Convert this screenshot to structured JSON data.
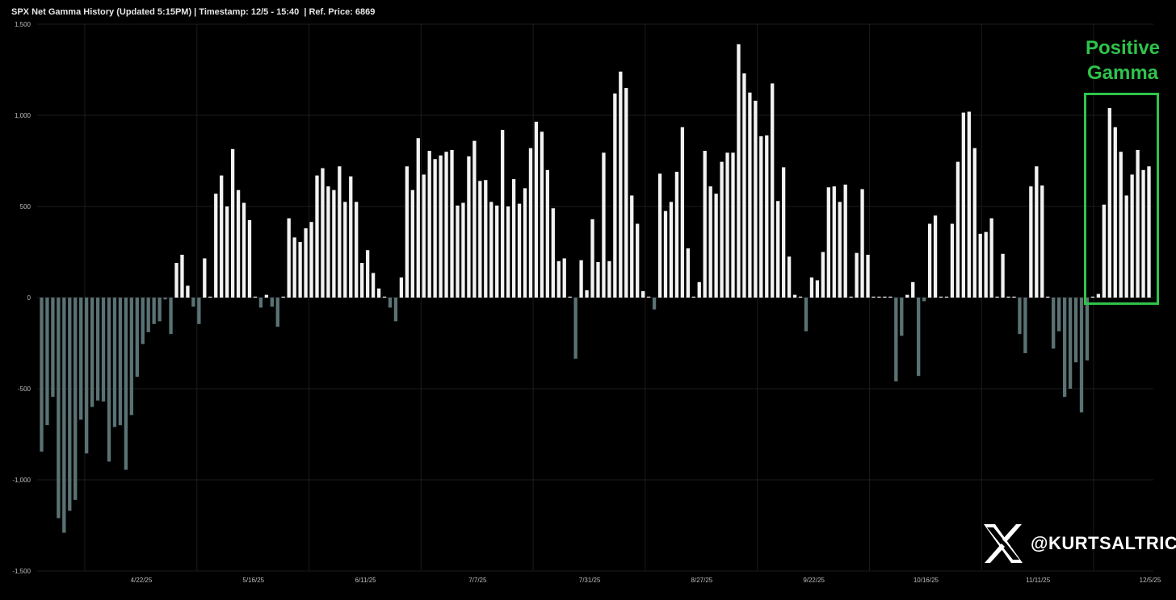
{
  "chart_data": {
    "type": "bar",
    "title": "SPX Net Gamma History (Updated 5:15PM) | Timestamp: 12/5 - 15:40  | Ref. Price: 6869",
    "xlabel": "",
    "ylabel": "",
    "ylim": [
      -1500,
      1500
    ],
    "yticks": [
      1500,
      1000,
      500,
      0,
      -500,
      -1000,
      -1500
    ],
    "ytick_labels": [
      "1,500",
      "1,000",
      "500",
      "0",
      "-500",
      "-1,000",
      "-1,500"
    ],
    "xtick_labels": [
      "4/22/25",
      "5/16/25",
      "6/11/25",
      "7/7/25",
      "7/31/25",
      "8/27/25",
      "9/22/25",
      "10/16/25",
      "11/11/25",
      "12/5/25"
    ],
    "grid": true,
    "colors": {
      "positive": "#f2f2f2",
      "negative": "#5a7274",
      "grid": "#1c1c1c",
      "background": "#000000"
    },
    "values": [
      -845,
      -700,
      -545,
      -1210,
      -1290,
      -1170,
      -1110,
      -670,
      -855,
      -600,
      -565,
      -570,
      -900,
      -710,
      -700,
      -945,
      -645,
      -435,
      -255,
      -190,
      -145,
      -130,
      -10,
      -200,
      190,
      235,
      65,
      -50,
      -145,
      215,
      0,
      570,
      670,
      500,
      815,
      590,
      520,
      425,
      0,
      -55,
      15,
      -50,
      -160,
      0,
      435,
      330,
      305,
      380,
      415,
      670,
      710,
      610,
      590,
      720,
      525,
      665,
      525,
      190,
      260,
      135,
      50,
      0,
      -55,
      -130,
      110,
      720,
      590,
      875,
      675,
      805,
      760,
      780,
      800,
      810,
      505,
      520,
      775,
      860,
      640,
      645,
      525,
      505,
      920,
      500,
      650,
      515,
      600,
      820,
      965,
      910,
      700,
      490,
      200,
      215,
      0,
      -335,
      205,
      40,
      430,
      195,
      795,
      200,
      1120,
      1240,
      1150,
      560,
      405,
      35,
      0,
      -65,
      680,
      475,
      525,
      690,
      935,
      270,
      0,
      85,
      805,
      610,
      570,
      745,
      795,
      795,
      1390,
      1230,
      1125,
      1080,
      885,
      890,
      1175,
      530,
      715,
      225,
      15,
      0,
      -185,
      110,
      95,
      250,
      605,
      610,
      525,
      620,
      0,
      245,
      595,
      235,
      0,
      0,
      0,
      0,
      -460,
      -210,
      15,
      85,
      -430,
      -20,
      405,
      450,
      0,
      0,
      405,
      745,
      1015,
      1020,
      820,
      350,
      360,
      435,
      0,
      240,
      0,
      0,
      -200,
      -305,
      610,
      720,
      615,
      0,
      -280,
      -185,
      -545,
      -500,
      -355,
      -630,
      -345,
      0,
      20,
      510,
      1040,
      935,
      800,
      560,
      675,
      810,
      700,
      720
    ]
  },
  "callout": {
    "line1": "Positive",
    "line2": "Gamma"
  },
  "watermark": {
    "icon": "x-logo-icon",
    "handle": "@KURTSALTRICHTER"
  }
}
